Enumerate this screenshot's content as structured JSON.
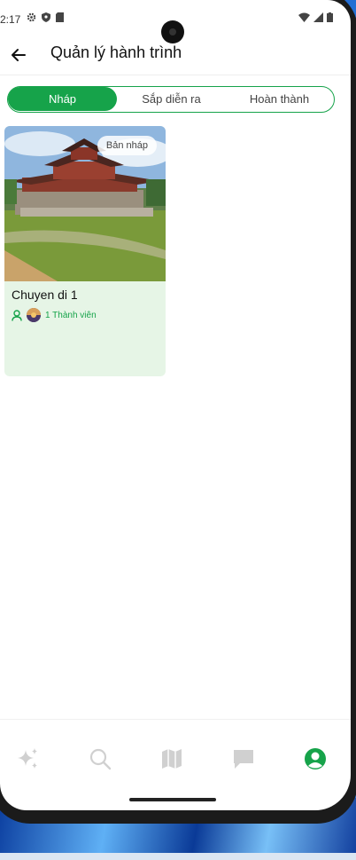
{
  "status_bar": {
    "time": "2:17"
  },
  "header": {
    "title": "Quản lý hành trình"
  },
  "tabs": [
    {
      "label": "Nháp",
      "active": true
    },
    {
      "label": "Sắp diễn ra",
      "active": false
    },
    {
      "label": "Hoàn thành",
      "active": false
    }
  ],
  "trips": [
    {
      "name": "Chuyen di 1",
      "status": "Bản nháp",
      "members": "1 Thành viên"
    }
  ],
  "bottom_nav": [
    {
      "icon": "sparkles-icon",
      "active": false
    },
    {
      "icon": "search-icon",
      "active": false
    },
    {
      "icon": "map-icon",
      "active": false
    },
    {
      "icon": "chat-icon",
      "active": false
    },
    {
      "icon": "profile-icon",
      "active": true
    }
  ],
  "colors": {
    "accent": "#16a34a",
    "card_bg": "#e6f5e6",
    "inactive_icon": "#d0d0d0"
  }
}
